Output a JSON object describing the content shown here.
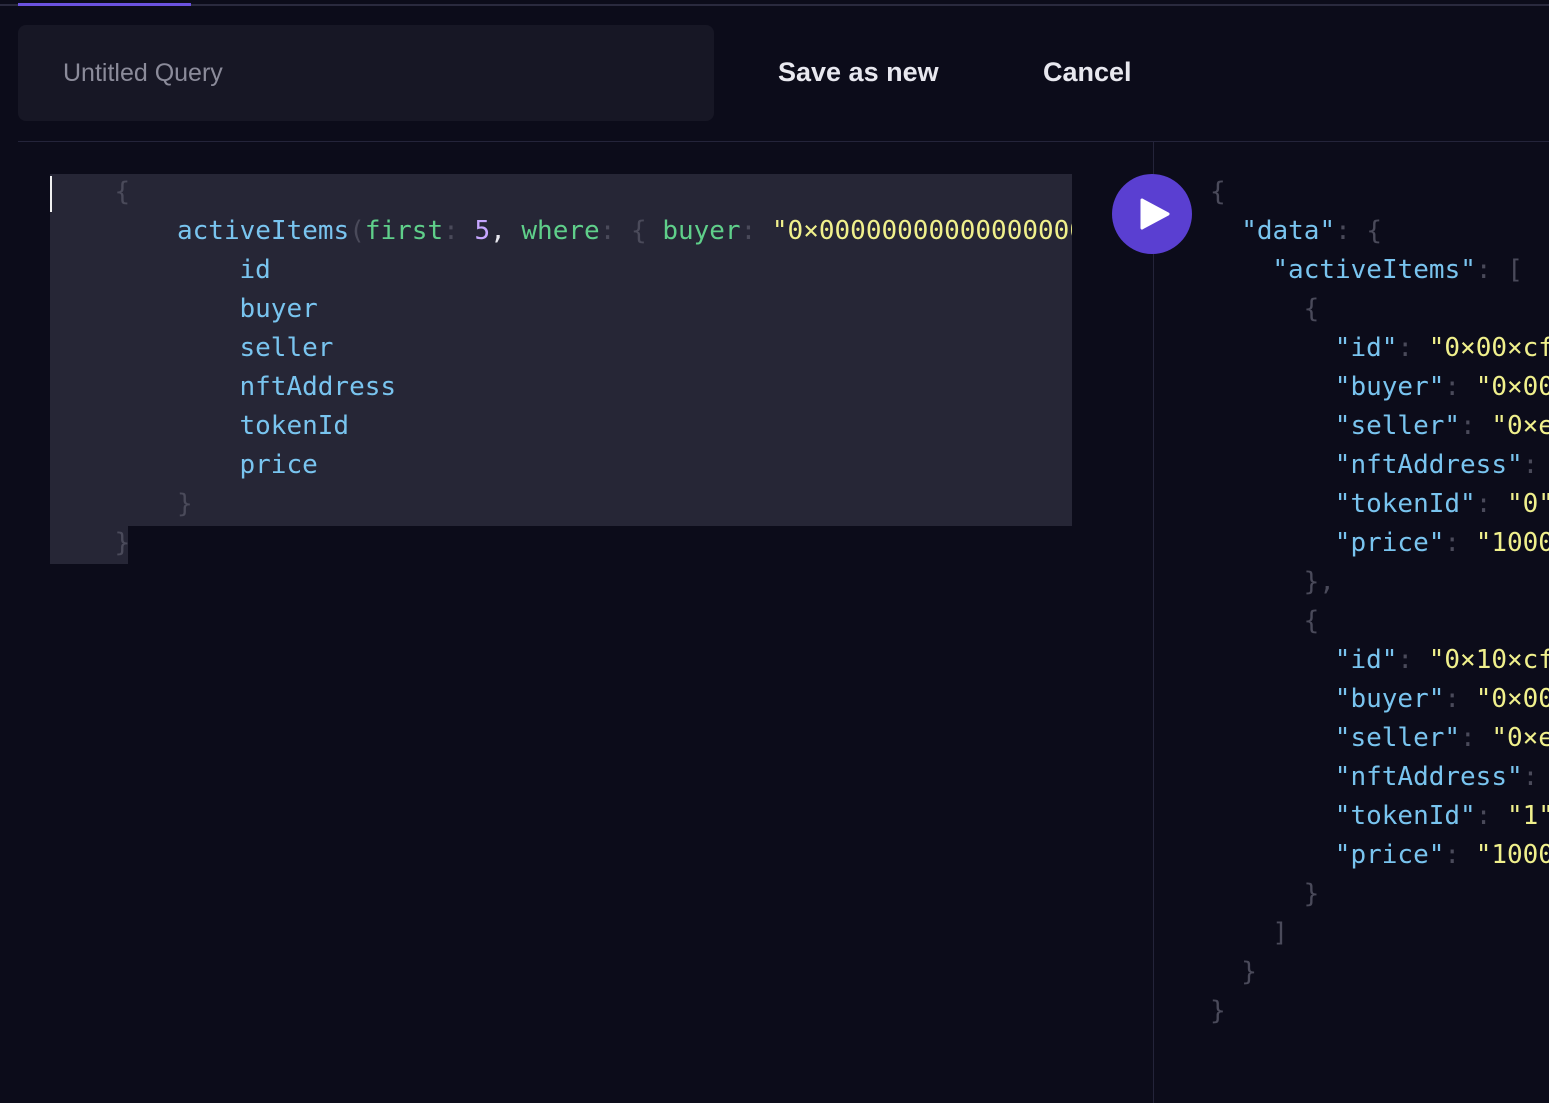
{
  "tab": {
    "active": true
  },
  "query_name": {
    "placeholder": "Untitled Query",
    "value": ""
  },
  "actions": {
    "save_label": "Save as new",
    "cancel_label": "Cancel"
  },
  "run_button": {
    "icon": "play-icon",
    "color": "#5a3fd1"
  },
  "editor": {
    "lines": [
      {
        "indent": 1,
        "tokens": [
          {
            "t": "{",
            "c": "punc"
          }
        ]
      },
      {
        "indent": 2,
        "tokens": [
          {
            "t": "activeItems",
            "c": "fld"
          },
          {
            "t": "(",
            "c": "punc"
          },
          {
            "t": "first",
            "c": "arg"
          },
          {
            "t": ": ",
            "c": "punc"
          },
          {
            "t": "5",
            "c": "num"
          },
          {
            "t": ", ",
            "c": "txt"
          },
          {
            "t": "where",
            "c": "arg"
          },
          {
            "t": ": ",
            "c": "punc"
          },
          {
            "t": "{ ",
            "c": "punc"
          },
          {
            "t": "buyer",
            "c": "arg"
          },
          {
            "t": ": ",
            "c": "punc"
          },
          {
            "t": "\"0×0000000000000000000",
            "c": "str"
          }
        ]
      },
      {
        "indent": 3,
        "tokens": [
          {
            "t": "id",
            "c": "fld"
          }
        ]
      },
      {
        "indent": 3,
        "tokens": [
          {
            "t": "buyer",
            "c": "fld"
          }
        ]
      },
      {
        "indent": 3,
        "tokens": [
          {
            "t": "seller",
            "c": "fld"
          }
        ]
      },
      {
        "indent": 3,
        "tokens": [
          {
            "t": "nftAddress",
            "c": "fld"
          }
        ]
      },
      {
        "indent": 3,
        "tokens": [
          {
            "t": "tokenId",
            "c": "fld"
          }
        ]
      },
      {
        "indent": 3,
        "tokens": [
          {
            "t": "price",
            "c": "fld"
          }
        ]
      },
      {
        "indent": 2,
        "tokens": [
          {
            "t": "}",
            "c": "punc"
          }
        ]
      },
      {
        "indent": 1,
        "tokens": [
          {
            "t": "}",
            "c": "punc"
          }
        ]
      }
    ]
  },
  "result": {
    "lines": [
      {
        "indent": 0,
        "tokens": [
          {
            "t": "{",
            "c": "punc"
          }
        ]
      },
      {
        "indent": 1,
        "tokens": [
          {
            "t": "\"data\"",
            "c": "fld"
          },
          {
            "t": ": {",
            "c": "punc"
          }
        ]
      },
      {
        "indent": 2,
        "tokens": [
          {
            "t": "\"activeItems\"",
            "c": "fld"
          },
          {
            "t": ": [",
            "c": "punc"
          }
        ]
      },
      {
        "indent": 3,
        "tokens": [
          {
            "t": "{",
            "c": "punc"
          }
        ]
      },
      {
        "indent": 4,
        "tokens": [
          {
            "t": "\"id\"",
            "c": "fld"
          },
          {
            "t": ": ",
            "c": "punc"
          },
          {
            "t": "\"0×00×cf",
            "c": "str"
          }
        ]
      },
      {
        "indent": 4,
        "tokens": [
          {
            "t": "\"buyer\"",
            "c": "fld"
          },
          {
            "t": ": ",
            "c": "punc"
          },
          {
            "t": "\"0×00",
            "c": "str"
          }
        ]
      },
      {
        "indent": 4,
        "tokens": [
          {
            "t": "\"seller\"",
            "c": "fld"
          },
          {
            "t": ": ",
            "c": "punc"
          },
          {
            "t": "\"0×e",
            "c": "str"
          }
        ]
      },
      {
        "indent": 4,
        "tokens": [
          {
            "t": "\"nftAddress\"",
            "c": "fld"
          },
          {
            "t": ":",
            "c": "punc"
          }
        ]
      },
      {
        "indent": 4,
        "tokens": [
          {
            "t": "\"tokenId\"",
            "c": "fld"
          },
          {
            "t": ": ",
            "c": "punc"
          },
          {
            "t": "\"0\"",
            "c": "str"
          }
        ]
      },
      {
        "indent": 4,
        "tokens": [
          {
            "t": "\"price\"",
            "c": "fld"
          },
          {
            "t": ": ",
            "c": "punc"
          },
          {
            "t": "\"1000",
            "c": "str"
          }
        ]
      },
      {
        "indent": 3,
        "tokens": [
          {
            "t": "},",
            "c": "punc"
          }
        ]
      },
      {
        "indent": 3,
        "tokens": [
          {
            "t": "{",
            "c": "punc"
          }
        ]
      },
      {
        "indent": 4,
        "tokens": [
          {
            "t": "\"id\"",
            "c": "fld"
          },
          {
            "t": ": ",
            "c": "punc"
          },
          {
            "t": "\"0×10×cf",
            "c": "str"
          }
        ]
      },
      {
        "indent": 4,
        "tokens": [
          {
            "t": "\"buyer\"",
            "c": "fld"
          },
          {
            "t": ": ",
            "c": "punc"
          },
          {
            "t": "\"0×00",
            "c": "str"
          }
        ]
      },
      {
        "indent": 4,
        "tokens": [
          {
            "t": "\"seller\"",
            "c": "fld"
          },
          {
            "t": ": ",
            "c": "punc"
          },
          {
            "t": "\"0×e",
            "c": "str"
          }
        ]
      },
      {
        "indent": 4,
        "tokens": [
          {
            "t": "\"nftAddress\"",
            "c": "fld"
          },
          {
            "t": ":",
            "c": "punc"
          }
        ]
      },
      {
        "indent": 4,
        "tokens": [
          {
            "t": "\"tokenId\"",
            "c": "fld"
          },
          {
            "t": ": ",
            "c": "punc"
          },
          {
            "t": "\"1\"",
            "c": "str"
          }
        ]
      },
      {
        "indent": 4,
        "tokens": [
          {
            "t": "\"price\"",
            "c": "fld"
          },
          {
            "t": ": ",
            "c": "punc"
          },
          {
            "t": "\"1000",
            "c": "str"
          }
        ]
      },
      {
        "indent": 3,
        "tokens": [
          {
            "t": "}",
            "c": "punc"
          }
        ]
      },
      {
        "indent": 2,
        "tokens": [
          {
            "t": "]",
            "c": "punc"
          }
        ]
      },
      {
        "indent": 1,
        "tokens": [
          {
            "t": "}",
            "c": "punc"
          }
        ]
      },
      {
        "indent": 0,
        "tokens": [
          {
            "t": "}",
            "c": "punc"
          }
        ]
      }
    ]
  }
}
